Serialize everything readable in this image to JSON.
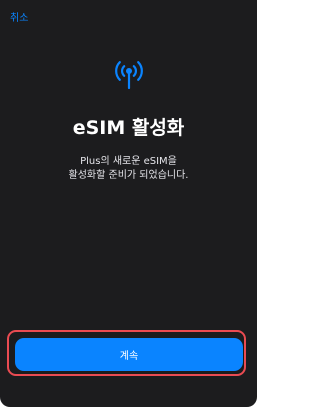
{
  "header": {
    "cancel_label": "취소"
  },
  "main": {
    "icon": "antenna-signal-icon",
    "title": "eSIM 활성화",
    "description_line1": "Plus의 새로운 eSIM을",
    "description_line2": "활성화할 준비가 되었습니다."
  },
  "footer": {
    "continue_label": "계속"
  },
  "colors": {
    "accent": "#0a84ff",
    "background": "#1c1c1e",
    "highlight": "#ea4b52"
  }
}
